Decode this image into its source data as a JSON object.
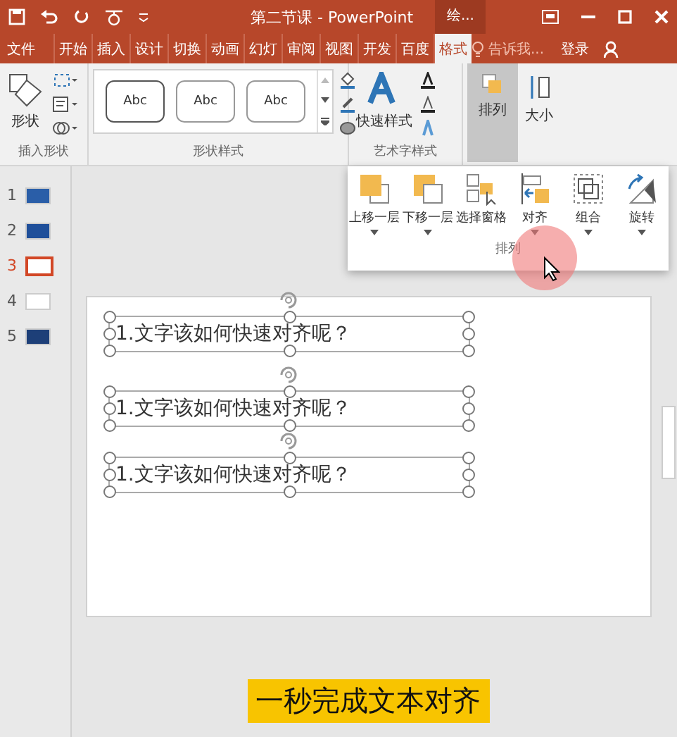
{
  "window": {
    "title": "第二节课 - PowerPoint",
    "context_tab": "绘..."
  },
  "tabs": [
    {
      "label": "文件",
      "selected": false
    },
    {
      "label": "开始",
      "selected": false
    },
    {
      "label": "插入",
      "selected": false
    },
    {
      "label": "设计",
      "selected": false
    },
    {
      "label": "切换",
      "selected": false
    },
    {
      "label": "动画",
      "selected": false
    },
    {
      "label": "幻灯",
      "selected": false
    },
    {
      "label": "审阅",
      "selected": false
    },
    {
      "label": "视图",
      "selected": false
    },
    {
      "label": "开发",
      "selected": false
    },
    {
      "label": "百度",
      "selected": false
    },
    {
      "label": "格式",
      "selected": true
    }
  ],
  "tell_me": "告诉我...",
  "sign_in": "登录",
  "ribbon": {
    "shape_button": "形状",
    "insert_shapes_group": "插入形状",
    "style_samples": [
      {
        "label": "Abc"
      },
      {
        "label": "Abc"
      },
      {
        "label": "Abc"
      }
    ],
    "shape_styles_group": "形状样式",
    "quick_styles": "快速样式",
    "wordart_group": "艺术字样式",
    "arrange": {
      "label": "排列",
      "selected": true
    },
    "size": "大小"
  },
  "arrange_menu": {
    "items": [
      {
        "label": "上移一层",
        "kind": "forward",
        "has_menu": true
      },
      {
        "label": "下移一层",
        "kind": "backward",
        "has_menu": true
      },
      {
        "label": "选择窗格",
        "kind": "pane",
        "has_menu": false
      },
      {
        "label": "对齐",
        "kind": "align",
        "has_menu": true
      },
      {
        "label": "组合",
        "kind": "group",
        "has_menu": true
      },
      {
        "label": "旋转",
        "kind": "rotate",
        "has_menu": true
      }
    ],
    "group_label": "排列"
  },
  "slides": [
    {
      "number": "1",
      "selected": false
    },
    {
      "number": "2",
      "selected": false
    },
    {
      "number": "3",
      "selected": true
    },
    {
      "number": "4",
      "selected": false
    },
    {
      "number": "5",
      "selected": false
    }
  ],
  "text_boxes": [
    {
      "text": "1.文字该如何快速对齐呢？",
      "selected": true
    },
    {
      "text": "1.文字该如何快速对齐呢？",
      "selected": true
    },
    {
      "text": "1.文字该如何快速对齐呢？",
      "selected": true
    }
  ],
  "caption": "一秒完成文本对齐"
}
